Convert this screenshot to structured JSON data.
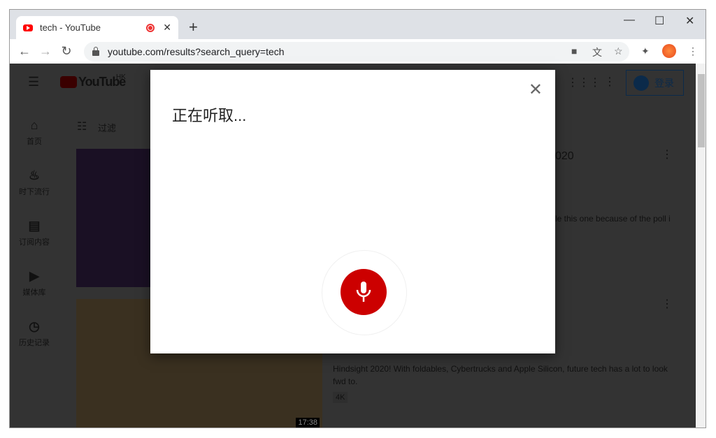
{
  "browser": {
    "tab_title": "tech - YouTube",
    "url": "youtube.com/results?search_query=tech",
    "new_tab": "+",
    "minimize": "—",
    "maximize": "☐",
    "close": "✕"
  },
  "youtube": {
    "logo": "YouTube",
    "region": "HK",
    "signin": "登录",
    "filter": "过滤",
    "sidebar": [
      {
        "label": "首页",
        "icon": "home-icon"
      },
      {
        "label": "时下流行",
        "icon": "trending-icon"
      },
      {
        "label": "订阅内容",
        "icon": "subscriptions-icon"
      },
      {
        "label": "媒体库",
        "icon": "library-icon"
      },
      {
        "label": "历史记录",
        "icon": "history-icon"
      }
    ],
    "results": [
      {
        "title_fragment": "020",
        "desc_fragment": "le this one because of the poll i"
      },
      {
        "desc": "Hindsight 2020! With foldables, Cybertrucks and Apple Silicon, future tech has a lot to look fwd to.",
        "badge": "4K",
        "duration": "17:38"
      }
    ]
  },
  "voice_dialog": {
    "title": "正在听取...",
    "close": "✕",
    "mic_color": "#cc0000"
  }
}
